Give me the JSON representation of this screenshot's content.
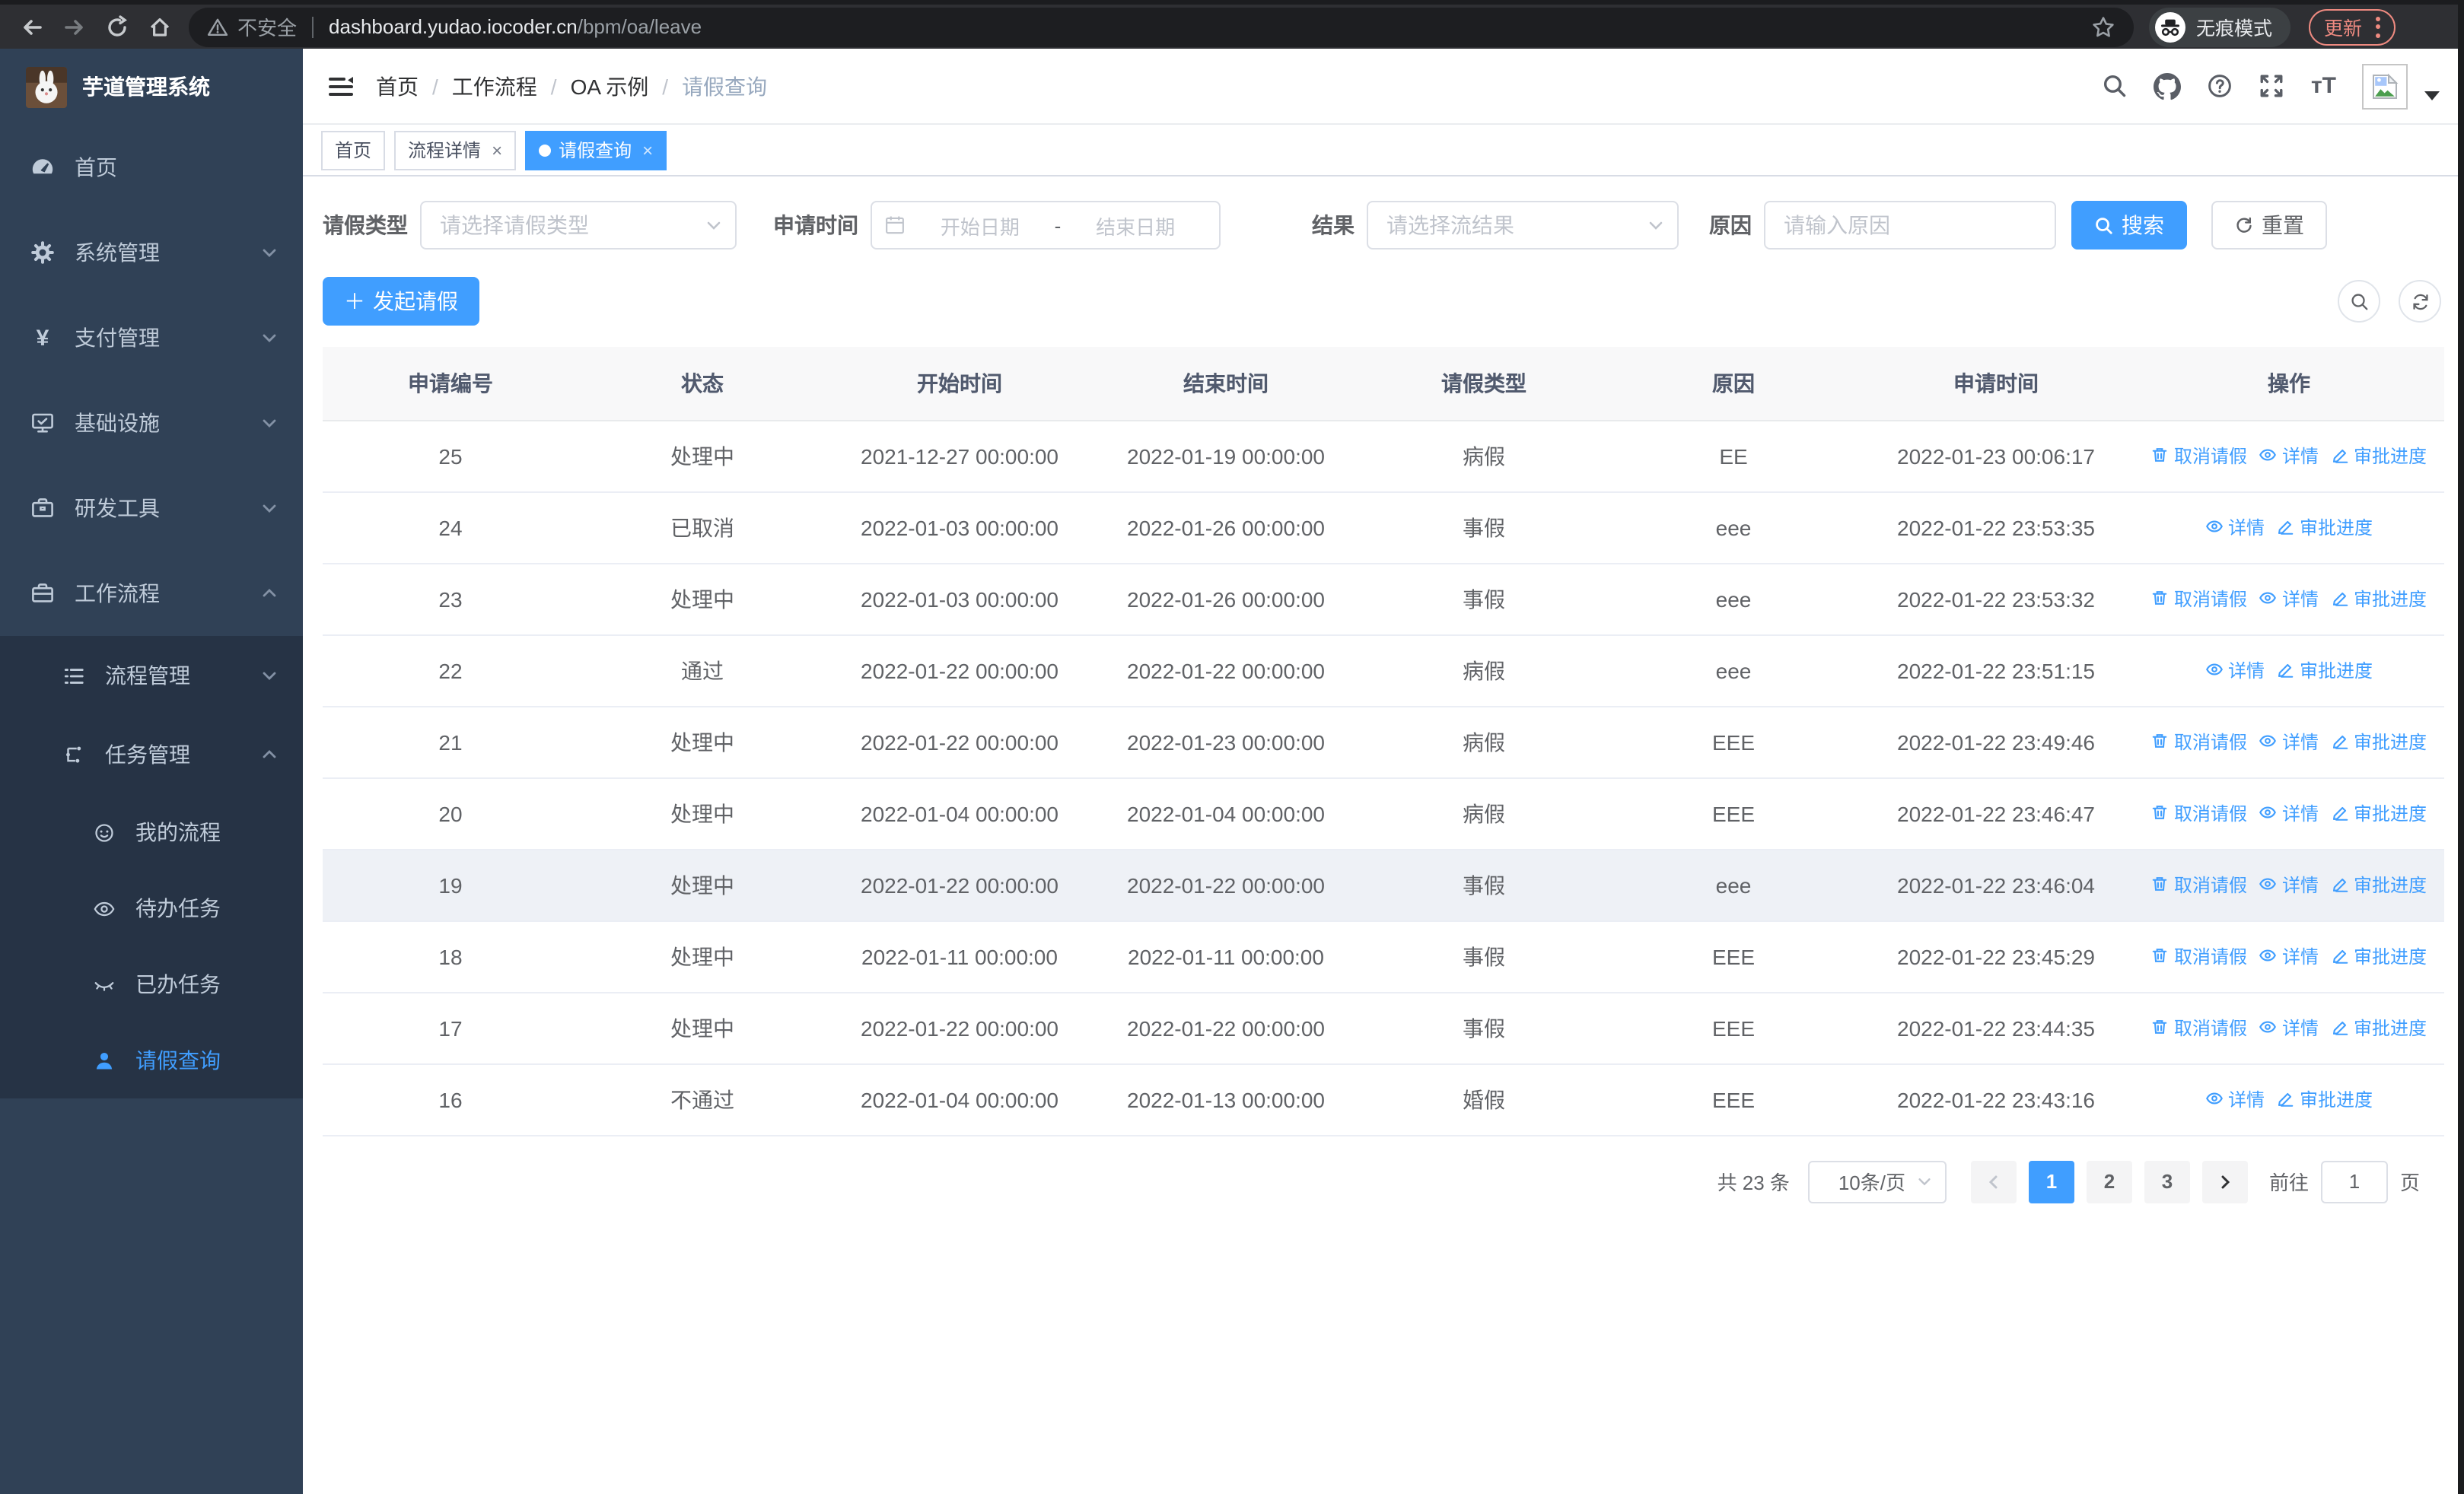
{
  "browser": {
    "security_label": "不安全",
    "url_host": "dashboard.yudao.iocoder.cn",
    "url_path": "/bpm/oa/leave",
    "incognito_label": "无痕模式",
    "update_label": "更新"
  },
  "sidebar": {
    "app_title": "芋道管理系统",
    "items": [
      {
        "label": "首页"
      },
      {
        "label": "系统管理"
      },
      {
        "label": "支付管理"
      },
      {
        "label": "基础设施"
      },
      {
        "label": "研发工具"
      },
      {
        "label": "工作流程"
      }
    ],
    "submenu_items": [
      {
        "label": "流程管理"
      },
      {
        "label": "任务管理"
      }
    ],
    "task_items": [
      {
        "label": "我的流程"
      },
      {
        "label": "待办任务"
      },
      {
        "label": "已办任务"
      },
      {
        "label": "请假查询"
      }
    ]
  },
  "header": {
    "breadcrumb": [
      {
        "label": "首页"
      },
      {
        "label": "工作流程"
      },
      {
        "label": "OA 示例"
      },
      {
        "label": "请假查询"
      }
    ],
    "separator": "/"
  },
  "tabs": [
    {
      "label": "首页"
    },
    {
      "label": "流程详情"
    },
    {
      "label": "请假查询"
    }
  ],
  "filters": {
    "leave_type_label": "请假类型",
    "leave_type_placeholder": "请选择请假类型",
    "apply_time_label": "申请时间",
    "start_date_placeholder": "开始日期",
    "range_separator": "-",
    "end_date_placeholder": "结束日期",
    "result_label": "结果",
    "result_placeholder": "请选择流结果",
    "reason_label": "原因",
    "reason_placeholder": "请输入原因",
    "search_label": "搜索",
    "reset_label": "重置"
  },
  "toolbar": {
    "create_label": "发起请假"
  },
  "table": {
    "columns": [
      "申请编号",
      "状态",
      "开始时间",
      "结束时间",
      "请假类型",
      "原因",
      "申请时间",
      "操作"
    ],
    "action_labels": {
      "cancel": "取消请假",
      "detail": "详情",
      "progress": "审批进度"
    },
    "rows": [
      {
        "id": "25",
        "status": "处理中",
        "start": "2021-12-27 00:00:00",
        "end": "2022-01-19 00:00:00",
        "type": "病假",
        "reason": "EE",
        "apply_time": "2022-01-23 00:06:17",
        "cancelable": true,
        "highlighted": false
      },
      {
        "id": "24",
        "status": "已取消",
        "start": "2022-01-03 00:00:00",
        "end": "2022-01-26 00:00:00",
        "type": "事假",
        "reason": "eee",
        "apply_time": "2022-01-22 23:53:35",
        "cancelable": false,
        "highlighted": false
      },
      {
        "id": "23",
        "status": "处理中",
        "start": "2022-01-03 00:00:00",
        "end": "2022-01-26 00:00:00",
        "type": "事假",
        "reason": "eee",
        "apply_time": "2022-01-22 23:53:32",
        "cancelable": true,
        "highlighted": false
      },
      {
        "id": "22",
        "status": "通过",
        "start": "2022-01-22 00:00:00",
        "end": "2022-01-22 00:00:00",
        "type": "病假",
        "reason": "eee",
        "apply_time": "2022-01-22 23:51:15",
        "cancelable": false,
        "highlighted": false
      },
      {
        "id": "21",
        "status": "处理中",
        "start": "2022-01-22 00:00:00",
        "end": "2022-01-23 00:00:00",
        "type": "病假",
        "reason": "EEE",
        "apply_time": "2022-01-22 23:49:46",
        "cancelable": true,
        "highlighted": false
      },
      {
        "id": "20",
        "status": "处理中",
        "start": "2022-01-04 00:00:00",
        "end": "2022-01-04 00:00:00",
        "type": "病假",
        "reason": "EEE",
        "apply_time": "2022-01-22 23:46:47",
        "cancelable": true,
        "highlighted": false
      },
      {
        "id": "19",
        "status": "处理中",
        "start": "2022-01-22 00:00:00",
        "end": "2022-01-22 00:00:00",
        "type": "事假",
        "reason": "eee",
        "apply_time": "2022-01-22 23:46:04",
        "cancelable": true,
        "highlighted": true
      },
      {
        "id": "18",
        "status": "处理中",
        "start": "2022-01-11 00:00:00",
        "end": "2022-01-11 00:00:00",
        "type": "事假",
        "reason": "EEE",
        "apply_time": "2022-01-22 23:45:29",
        "cancelable": true,
        "highlighted": false
      },
      {
        "id": "17",
        "status": "处理中",
        "start": "2022-01-22 00:00:00",
        "end": "2022-01-22 00:00:00",
        "type": "事假",
        "reason": "EEE",
        "apply_time": "2022-01-22 23:44:35",
        "cancelable": true,
        "highlighted": false
      },
      {
        "id": "16",
        "status": "不通过",
        "start": "2022-01-04 00:00:00",
        "end": "2022-01-13 00:00:00",
        "type": "婚假",
        "reason": "EEE",
        "apply_time": "2022-01-22 23:43:16",
        "cancelable": false,
        "highlighted": false
      }
    ]
  },
  "pagination": {
    "total": "共 23 条",
    "page_size": "10条/页",
    "pages": [
      "1",
      "2",
      "3"
    ],
    "active_page": "1",
    "goto_label": "前往",
    "goto_value": "1",
    "unit_label": "页"
  },
  "colors": {
    "primary": "#409eff",
    "sidebar_bg": "#304156",
    "submenu_bg": "#263345",
    "sidebar_text": "#bfcbd9",
    "table_header_bg": "#f8f8f9",
    "update_accent": "#ee8a80"
  }
}
